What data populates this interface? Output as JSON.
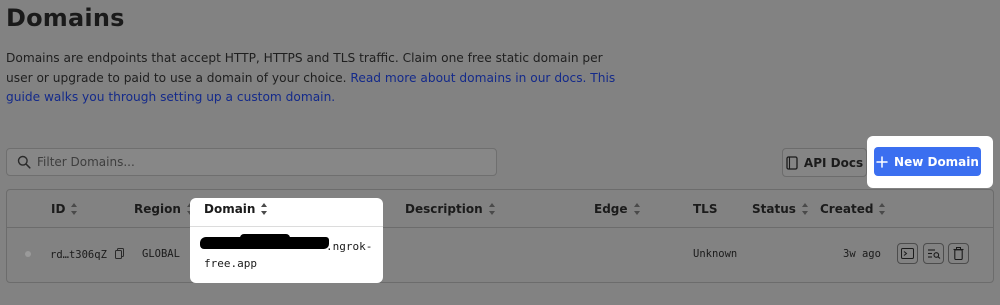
{
  "page": {
    "title": "Domains",
    "description": "Domains are endpoints that accept HTTP, HTTPS and TLS traffic. Claim one free static domain per user or upgrade to paid to use a domain of your choice. ",
    "description_link": "Read more about domains in our docs. This guide walks you through setting up a custom domain."
  },
  "toolbar": {
    "filter_placeholder": "Filter Domains...",
    "api_docs_label": "API Docs",
    "new_domain_label": "New Domain"
  },
  "table": {
    "columns": {
      "id": "ID",
      "region": "Region",
      "domain": "Domain",
      "description": "Description",
      "edge": "Edge",
      "tls": "TLS",
      "status": "Status",
      "created": "Created"
    },
    "rows": [
      {
        "id": "rd…t306qZ",
        "region": "GLOBAL",
        "domain_suffix": ".ngrok-",
        "domain_suffix2": "free.app",
        "description": "",
        "edge": "",
        "tls": "Unknown",
        "status": "",
        "created": "3w ago"
      }
    ]
  },
  "icons": {
    "search": "search-icon",
    "book": "book-icon",
    "plus": "plus-icon",
    "copy": "copy-icon",
    "terminal": "terminal-icon",
    "inspect": "inspect-icon",
    "trash": "trash-icon"
  },
  "colors": {
    "accent": "#3b6ff0",
    "link": "#142a8a",
    "highlight": "#ffffff"
  }
}
